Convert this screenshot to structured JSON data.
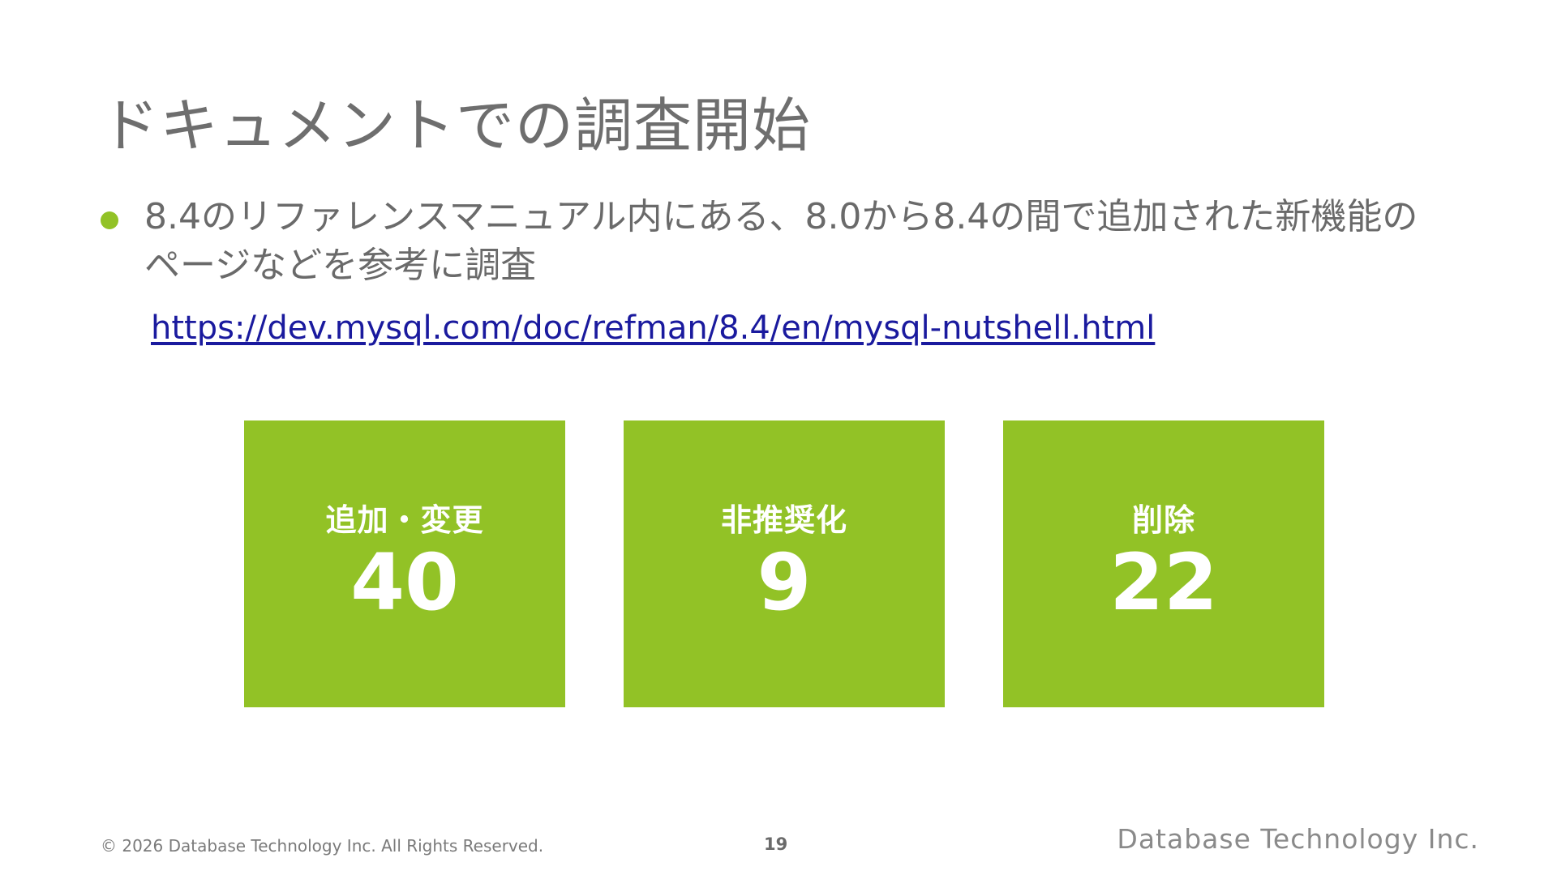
{
  "slide": {
    "title": "ドキュメントでの調査開始",
    "bullet": "8.4のリファレンスマニュアル内にある、8.0から8.4の間で追加された新機能のページなどを参考に調査",
    "link": "https://dev.mysql.com/doc/refman/8.4/en/mysql-nutshell.html",
    "cards": [
      {
        "label": "追加・変更",
        "value": "40"
      },
      {
        "label": "非推奨化",
        "value": "9"
      },
      {
        "label": "削除",
        "value": "22"
      }
    ]
  },
  "footer": {
    "copyright": "© 2026 Database Technology Inc. All Rights Reserved.",
    "page_number": "19",
    "logo": "Database Technology Inc."
  },
  "colors": {
    "accent": "#92c226",
    "title": "#6e6e6e",
    "link": "#1a1a9e"
  }
}
